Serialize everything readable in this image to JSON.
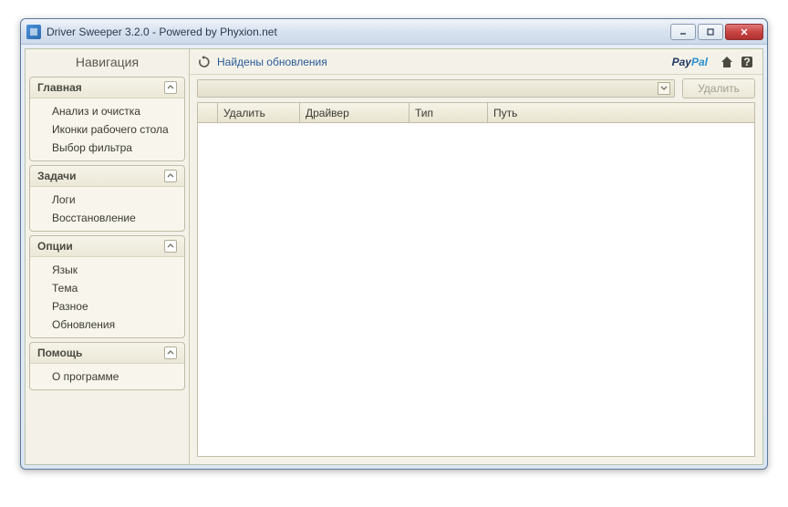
{
  "window": {
    "title": "Driver Sweeper 3.2.0 - Powered by Phyxion.net"
  },
  "sidebar": {
    "title": "Навигация",
    "groups": [
      {
        "label": "Главная",
        "items": [
          "Анализ и очистка",
          "Иконки рабочего стола",
          "Выбор фильтра"
        ]
      },
      {
        "label": "Задачи",
        "items": [
          "Логи",
          "Восстановление"
        ]
      },
      {
        "label": "Опции",
        "items": [
          "Язык",
          "Тема",
          "Разное",
          "Обновления"
        ]
      },
      {
        "label": "Помощь",
        "items": [
          "О программе"
        ]
      }
    ]
  },
  "topbar": {
    "update_link": "Найдены обновления",
    "paypal_a": "Pay",
    "paypal_b": "Pal"
  },
  "toolbar": {
    "delete_label": "Удалить"
  },
  "grid": {
    "columns": {
      "delete": "Удалить",
      "driver": "Драйвер",
      "type": "Тип",
      "path": "Путь"
    }
  }
}
